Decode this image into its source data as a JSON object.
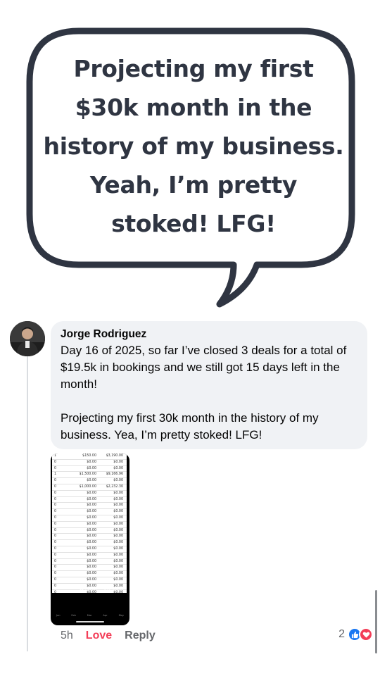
{
  "speech_bubble": {
    "quote": "Projecting my first $30k month in the history of my business. Yeah, I’m pretty stoked! LFG!"
  },
  "comment": {
    "author": "Jorge Rodriguez",
    "text": "Day 16 of 2025, so far I’ve closed 3 deals for a total of $19.5k in bookings and we still got 15 days left in the month!\n\nProjecting my first 30k month in the history of my business. Yea, I’m pretty stoked! LFG!",
    "time": "5h",
    "love_label": "Love",
    "reply_label": "Reply",
    "reaction_count": "2"
  },
  "attachment": {
    "rows": [
      [
        "1",
        "$150.00",
        "$3,190.00"
      ],
      [
        "0",
        "$0.00",
        "$0.00"
      ],
      [
        "0",
        "$0.00",
        "$0.00"
      ],
      [
        "1",
        "$1,500.00",
        "$9,166.96"
      ],
      [
        "0",
        "$0.00",
        "$0.00"
      ],
      [
        "0",
        "$1,000.00",
        "$2,232.30"
      ],
      [
        "0",
        "$0.00",
        "$0.00"
      ],
      [
        "0",
        "$0.00",
        "$0.00"
      ],
      [
        "0",
        "$0.00",
        "$0.00"
      ],
      [
        "0",
        "$0.00",
        "$0.00"
      ],
      [
        "0",
        "$0.00",
        "$0.00"
      ],
      [
        "0",
        "$0.00",
        "$0.00"
      ],
      [
        "0",
        "$0.00",
        "$0.00"
      ],
      [
        "0",
        "$0.00",
        "$0.00"
      ],
      [
        "0",
        "$0.00",
        "$0.00"
      ],
      [
        "0",
        "$0.00",
        "$0.00"
      ],
      [
        "0",
        "$0.00",
        "$0.00"
      ],
      [
        "0",
        "$0.00",
        "$0.00"
      ],
      [
        "0",
        "$0.00",
        "$0.00"
      ],
      [
        "0",
        "$0.00",
        "$0.00"
      ],
      [
        "0",
        "$0.00",
        "$0.00"
      ],
      [
        "0",
        "$0.00",
        "$0.00"
      ],
      [
        "0",
        "$0.00",
        "$0.00"
      ],
      [
        "0",
        "$0.00",
        "$0.00"
      ]
    ],
    "total": [
      "3",
      "$4,750.00",
      "$19,569.35"
    ],
    "tabs": [
      "Jan",
      "Feb",
      "Mar",
      "Apr",
      "May"
    ]
  },
  "icons": {
    "like": "thumbs-up-icon",
    "love": "heart-icon"
  },
  "colors": {
    "bubble_stroke": "#2f3542",
    "love": "#f33e58",
    "like": "#1877f2",
    "comment_bg": "#f0f2f5"
  }
}
